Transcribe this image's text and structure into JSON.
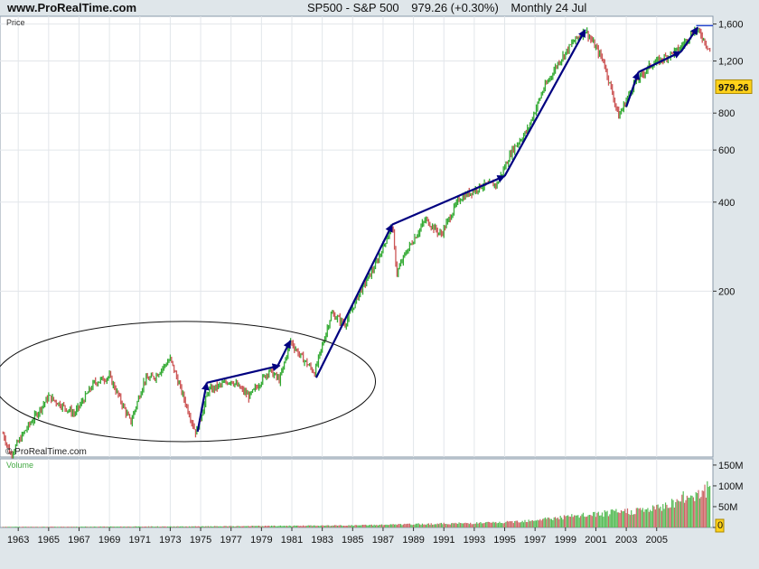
{
  "header": {
    "site": "www.ProRealTime.com",
    "symbol": "SP500 - S&P 500",
    "price": "979.26 (+0.30%)",
    "period": "Monthly  24 Jul"
  },
  "chart_data": [
    {
      "type": "candlestick",
      "title": "Price",
      "watermark": "© ProRealTime.com",
      "y_scale": "log",
      "ylim": [
        55,
        1700
      ],
      "y_ticks": [
        200,
        400,
        600,
        800,
        1200,
        1600
      ],
      "y_tick_labels": [
        "200",
        "400",
        "600",
        "800",
        "1,200",
        "1,600"
      ],
      "last_price_label": "979.26",
      "grid": true,
      "x_ticks": [
        "1963",
        "1965",
        "1967",
        "1969",
        "1971",
        "1973",
        "1975",
        "1977",
        "1979",
        "1981",
        "1983",
        "1985",
        "1987",
        "1989",
        "1991",
        "1993",
        "1995",
        "1997",
        "1999",
        "2001",
        "2003",
        "2005"
      ],
      "price_path": [
        [
          1962.0,
          66
        ],
        [
          1962.5,
          56
        ],
        [
          1963.5,
          68
        ],
        [
          1965.0,
          88
        ],
        [
          1966.7,
          77
        ],
        [
          1968.0,
          98
        ],
        [
          1969.0,
          103
        ],
        [
          1970.4,
          72
        ],
        [
          1971.3,
          100
        ],
        [
          1972.0,
          103
        ],
        [
          1973.0,
          118
        ],
        [
          1974.7,
          66
        ],
        [
          1975.5,
          92
        ],
        [
          1977.0,
          100
        ],
        [
          1978.2,
          88
        ],
        [
          1979.5,
          108
        ],
        [
          1980.2,
          100
        ],
        [
          1980.9,
          136
        ],
        [
          1981.5,
          122
        ],
        [
          1982.5,
          106
        ],
        [
          1983.6,
          168
        ],
        [
          1984.5,
          155
        ],
        [
          1985.5,
          200
        ],
        [
          1986.5,
          245
        ],
        [
          1987.6,
          335
        ],
        [
          1987.9,
          230
        ],
        [
          1988.5,
          270
        ],
        [
          1989.8,
          350
        ],
        [
          1990.8,
          310
        ],
        [
          1992.0,
          410
        ],
        [
          1993.5,
          455
        ],
        [
          1994.5,
          460
        ],
        [
          1995.5,
          600
        ],
        [
          1996.5,
          700
        ],
        [
          1997.5,
          950
        ],
        [
          1998.5,
          1180
        ],
        [
          1999.5,
          1390
        ],
        [
          2000.3,
          1530
        ],
        [
          2001.5,
          1200
        ],
        [
          2002.5,
          780
        ],
        [
          2003.5,
          1000
        ],
        [
          2004.5,
          1150
        ],
        [
          2005.5,
          1230
        ],
        [
          2006.5,
          1320
        ],
        [
          2007.5,
          1530
        ],
        [
          2007.9,
          1480
        ],
        [
          2008.5,
          1300
        ]
      ],
      "arrows": [
        {
          "from": [
            1974.8,
            67
          ],
          "to": [
            1975.4,
            98
          ]
        },
        {
          "from": [
            1975.4,
            98
          ],
          "to": [
            1980.2,
            112
          ]
        },
        {
          "from": [
            1980.0,
            110
          ],
          "to": [
            1980.9,
            136
          ]
        },
        {
          "from": [
            1982.6,
            102
          ],
          "to": [
            1987.6,
            336
          ]
        },
        {
          "from": [
            1987.6,
            336
          ],
          "to": [
            1995.0,
            490
          ]
        },
        {
          "from": [
            1995.0,
            490
          ],
          "to": [
            2000.3,
            1530
          ]
        },
        {
          "from": [
            2003.0,
            840
          ],
          "to": [
            2003.8,
            1100
          ]
        },
        {
          "from": [
            2003.8,
            1100
          ],
          "to": [
            2006.6,
            1290
          ]
        },
        {
          "from": [
            2006.6,
            1290
          ],
          "to": [
            2007.7,
            1560
          ]
        }
      ],
      "ellipse_span": {
        "x_range": [
          1961.4,
          1986.5
        ],
        "y_range": [
          62,
          158
        ]
      }
    },
    {
      "type": "bar",
      "title": "Volume",
      "y_tick_labels": [
        "150M",
        "100M",
        "50M",
        "0"
      ],
      "y_ticks": [
        150,
        100,
        50,
        0
      ],
      "ylim": [
        0,
        165
      ],
      "volume_trend": [
        [
          1962.0,
          1.5
        ],
        [
          1975.0,
          2.5
        ],
        [
          1985.0,
          5
        ],
        [
          1995.0,
          12
        ],
        [
          2000.0,
          28
        ],
        [
          2005.0,
          45
        ],
        [
          2008.5,
          95
        ]
      ]
    }
  ]
}
